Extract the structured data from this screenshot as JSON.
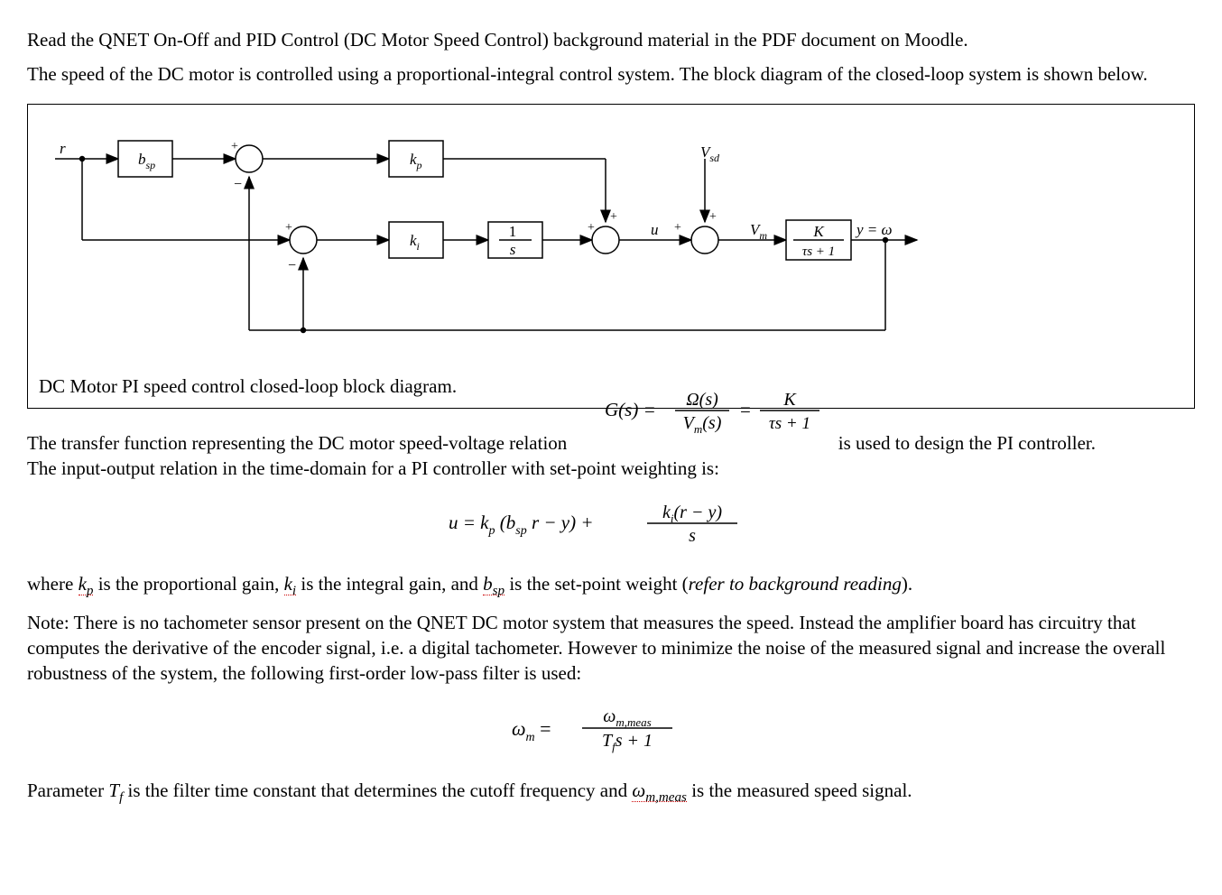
{
  "p1": "Read the QNET On-Off and PID Control (DC Motor Speed Control) background material in the PDF document on Moodle.",
  "p2": "The speed of the DC motor is controlled using a proportional-integral control system. The block diagram of the closed-loop system is shown below.",
  "diagram": {
    "caption": "DC Motor PI speed control closed-loop block diagram.",
    "labels": {
      "input": "r",
      "bsp": "b",
      "bsp_sub": "sp",
      "kp": "k",
      "kp_sub": "p",
      "ki": "k",
      "ki_sub": "i",
      "integ_num": "1",
      "integ_den": "s",
      "vsd": "V",
      "vsd_sub": "sd",
      "u": "u",
      "vm": "V",
      "vm_sub": "m",
      "plant_num": "K",
      "plant_den": "τs + 1",
      "output": "y = ω",
      "plus": "+",
      "minus": "−"
    }
  },
  "p3a": "The transfer function representing the DC motor speed-voltage relation",
  "p3b": "is used to design the PI controller.",
  "p4": "The input-output relation in the time-domain for a PI controller with set-point weighting is:",
  "eq_G": {
    "lhs": "G(s) =",
    "frac1_num": "Ω(s)",
    "frac1_den": "V",
    "frac1_den_sub": "m",
    "frac1_den_tail": "(s)",
    "mid": "=",
    "frac2_num": "K",
    "frac2_den": "τs + 1"
  },
  "eq_u": {
    "text": "u = k",
    "kp_sub": "p",
    "mid1": "(b",
    "bsp_sub": "sp",
    "mid2": "r − y) +",
    "frac_num_a": "k",
    "frac_num_ki_sub": "i",
    "frac_num_b": "(r − y)",
    "frac_den": "s"
  },
  "p5a": "where ",
  "p5_kp": "k",
  "p5_kp_sub": "p",
  "p5b": " is the proportional gain, ",
  "p5_ki": "k",
  "p5_ki_sub": "i",
  "p5c": " is the integral gain, and ",
  "p5_bsp": "b",
  "p5_bsp_sub": "sp",
  "p5d": " is the set-point weight (",
  "p5e": "refer to background reading",
  "p5f": ").",
  "p6": "Note:  There is no tachometer sensor present on the QNET DC motor system that measures the speed. Instead the amplifier board has circuitry that computes the derivative of the encoder signal, i.e. a digital tachometer. However to minimize the noise of the measured signal and increase the overall robustness of the system, the following first-order low-pass filter is used:",
  "eq_omega": {
    "lhs": "ω",
    "lhs_sub": "m",
    "eq": " = ",
    "num": "ω",
    "num_sub": "m,meas",
    "den_a": "T",
    "den_sub": "f",
    "den_b": "s + 1"
  },
  "p7a": "Parameter ",
  "p7_tf": "T",
  "p7_tf_sub": "f",
  "p7b": " is the filter time constant that determines the cutoff frequency and ",
  "p7_om": "ω",
  "p7_om_sub": "m,meas",
  "p7c": " is the measured speed signal."
}
